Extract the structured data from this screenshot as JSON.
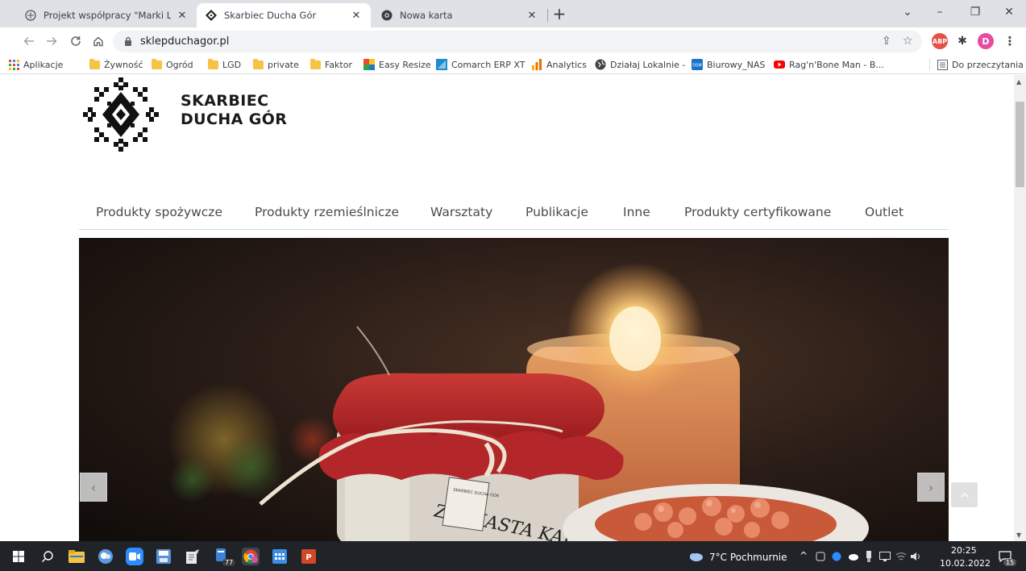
{
  "browser": {
    "tabs": [
      {
        "title": "Projekt współpracy \"Marki Lokaln",
        "active": false
      },
      {
        "title": "Skarbiec Ducha Gór",
        "active": true
      },
      {
        "title": "Nowa karta",
        "active": false
      }
    ],
    "new_tab": "+",
    "window_controls": {
      "minimize": "–",
      "restore": "❐",
      "close": "✕",
      "dropdown": "⌄"
    },
    "url": "sklepduchagor.pl",
    "avatar_letter": "D",
    "abp_label": "ABP"
  },
  "bookmarks": [
    {
      "label": "Aplikacje",
      "icon": "apps-grid-icon"
    },
    {
      "label": "Żywność",
      "icon": "folder-icon"
    },
    {
      "label": "Ogród",
      "icon": "folder-icon"
    },
    {
      "label": "LGD",
      "icon": "folder-icon"
    },
    {
      "label": "private",
      "icon": "folder-icon"
    },
    {
      "label": "Faktor",
      "icon": "folder-icon"
    },
    {
      "label": "Easy Resize",
      "icon": "easy-resize-icon"
    },
    {
      "label": "Comarch ERP XT",
      "icon": "comarch-icon"
    },
    {
      "label": "Analytics",
      "icon": "analytics-icon"
    },
    {
      "label": "Działaj Lokalnie -",
      "icon": "globe-icon"
    },
    {
      "label": "Biurowy_NAS",
      "icon": "nas-icon"
    },
    {
      "label": "Rag'n'Bone Man - B...",
      "icon": "youtube-icon"
    }
  ],
  "reading_list": "Do przeczytania",
  "site": {
    "logo_line1": "SKARBIEC",
    "logo_line2": "DUCHA GÓR",
    "nav": [
      "Produkty spożywcze",
      "Produkty rzemieślnicze",
      "Warsztaty",
      "Publikacje",
      "Inne",
      "Produkty certyfikowane",
      "Outlet"
    ],
    "slider_prev": "‹",
    "slider_next": "›",
    "jar_label": "ZIOMASTA KARKONOSKA",
    "jar_sticker": "SKARBIEC DUCHA GÓR"
  },
  "taskbar": {
    "weather": "7°C  Pochmurnie",
    "time": "20:25",
    "date": "10.02.2022",
    "teams_badge": "77",
    "notif_badge": "15"
  },
  "colors": {
    "tabstrip": "#dee1e6",
    "taskbar": "#202328",
    "nav_text": "#4a4a4a",
    "jar_cloth": "#b8252a"
  }
}
